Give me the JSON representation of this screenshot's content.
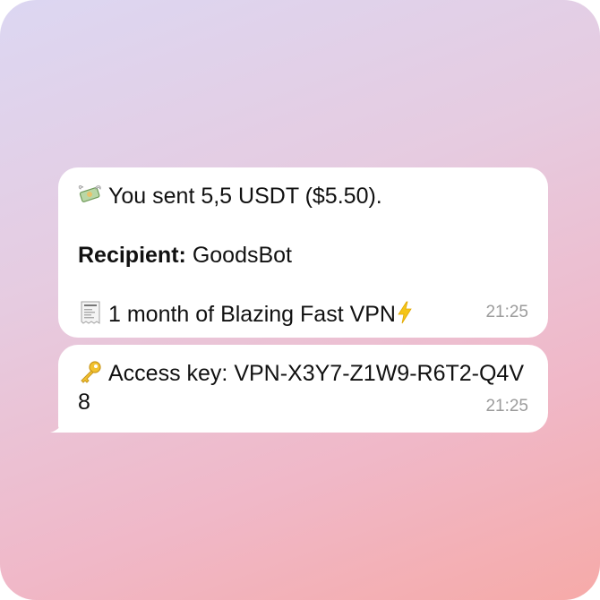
{
  "messages": [
    {
      "icon": "money-with-wings-icon",
      "line1": "You sent 5,5 USDT ($5.50).",
      "recipient_label": "Recipient:",
      "recipient_value": "GoodsBot",
      "receipt_icon": "receipt-icon",
      "item": "1 month of Blazing Fast VPN",
      "item_suffix_icon": "lightning-icon",
      "time": "21:25"
    },
    {
      "icon": "key-icon",
      "text": "Access key: VPN-X3Y7-Z1W9-R6T2-Q4V8",
      "time": "21:25"
    }
  ],
  "colors": {
    "bubble": "#ffffff",
    "timestamp": "#9b9b9b",
    "gradient_top": "#dcd7f2",
    "gradient_bottom": "#f6aaa8"
  }
}
